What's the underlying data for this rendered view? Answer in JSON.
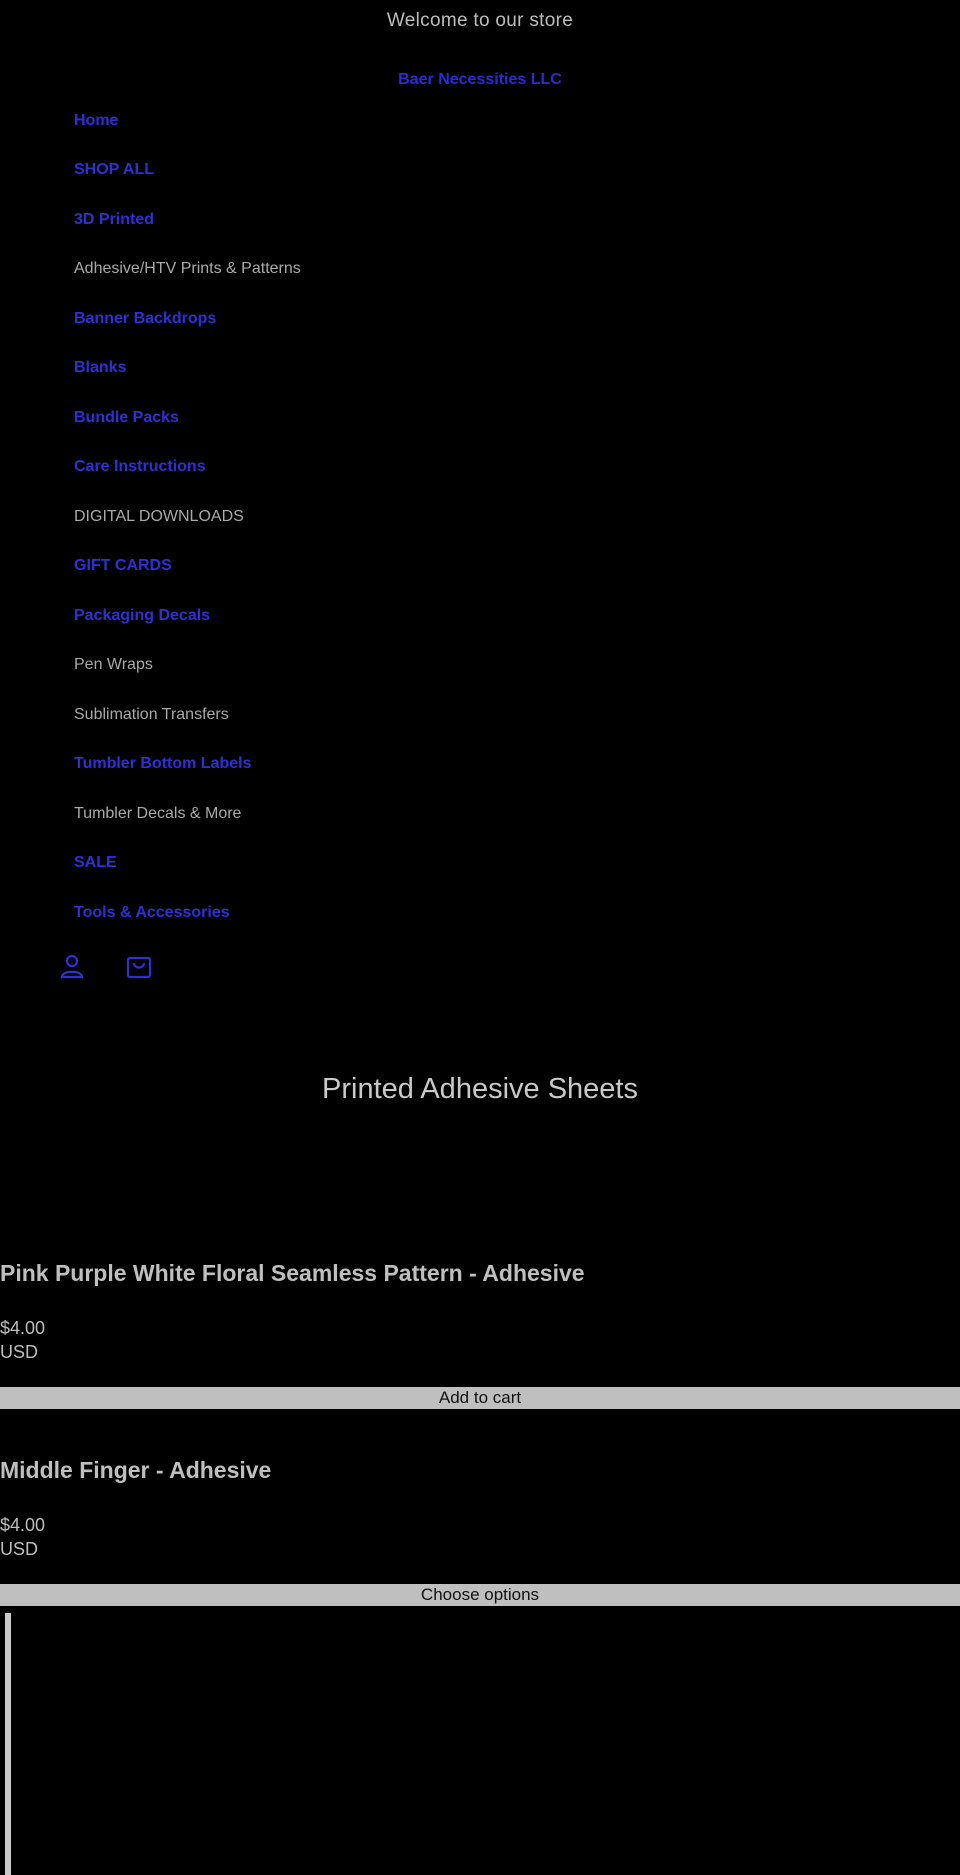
{
  "header": {
    "announcement": "Welcome to our store",
    "brand": "Baer Necessities LLC"
  },
  "nav": {
    "items": [
      {
        "label": "Home",
        "style": "link"
      },
      {
        "label": "SHOP ALL",
        "style": "link"
      },
      {
        "label": "3D Printed",
        "style": "link"
      },
      {
        "label": "Adhesive/HTV Prints & Patterns",
        "style": "plain"
      },
      {
        "label": "Banner Backdrops",
        "style": "link"
      },
      {
        "label": "Blanks",
        "style": "link"
      },
      {
        "label": "Bundle Packs",
        "style": "link"
      },
      {
        "label": "Care Instructions",
        "style": "link"
      },
      {
        "label": "DIGITAL DOWNLOADS",
        "style": "plain"
      },
      {
        "label": "GIFT CARDS",
        "style": "link"
      },
      {
        "label": "Packaging Decals",
        "style": "link"
      },
      {
        "label": "Pen Wraps",
        "style": "plain"
      },
      {
        "label": "Sublimation Transfers",
        "style": "plain"
      },
      {
        "label": "Tumbler Bottom Labels",
        "style": "link"
      },
      {
        "label": "Tumbler Decals & More",
        "style": "plain"
      },
      {
        "label": "SALE",
        "style": "link"
      },
      {
        "label": "Tools & Accessories",
        "style": "link"
      }
    ],
    "account_icon": "account-icon",
    "cart_icon": "cart-icon"
  },
  "collection": {
    "title": "Printed Adhesive Sheets"
  },
  "products": [
    {
      "title": "Pink Purple White Floral Seamless Pattern - Adhesive",
      "price": "$4.00",
      "currency": "USD",
      "button": "Add to cart"
    },
    {
      "title": "Middle Finger - Adhesive",
      "price": "$4.00",
      "currency": "USD",
      "button": "Choose options"
    }
  ],
  "colors": {
    "background": "#000000",
    "link": "#2f2fd6",
    "text": "#bdbdbd",
    "button": "#bfbfbf"
  }
}
